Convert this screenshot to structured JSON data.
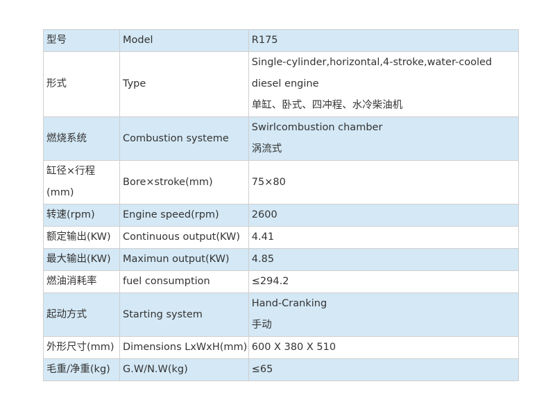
{
  "rows": [
    {
      "zh": "型号",
      "en": "Model",
      "value": [
        "R175"
      ]
    },
    {
      "zh": "形式",
      "en": "Type",
      "value": [
        "Single-cylinder,horizontal,4-stroke,water-cooled",
        "diesel engine",
        "单缸、卧式、四冲程、水冷柴油机"
      ]
    },
    {
      "zh": "燃烧系统",
      "en": "Combustion systeme",
      "value": [
        "Swirlcombustion chamber",
        "涡流式"
      ]
    },
    {
      "zh": [
        "缸径×行程",
        "(mm)"
      ],
      "en": "Bore×stroke(mm)",
      "value": [
        "75×80"
      ]
    },
    {
      "zh": "转速(rpm)",
      "en": "Engine speed(rpm)",
      "value": [
        "2600"
      ]
    },
    {
      "zh": "额定输出(KW)",
      "en": "Continuous output(KW)",
      "value": [
        "4.41"
      ]
    },
    {
      "zh": "最大输出(KW)",
      "en": "Maximun output(KW)",
      "value": [
        "4.85"
      ]
    },
    {
      "zh": "燃油消耗率",
      "en": "fuel consumption",
      "value": [
        "≤294.2"
      ]
    },
    {
      "zh": "起动方式",
      "en": "Starting system",
      "value": [
        "Hand-Cranking",
        "手动"
      ]
    },
    {
      "zh": "外形尺寸(mm)",
      "en": "Dimensions LxWxH(mm)",
      "value": [
        "600 X 380 X 510"
      ]
    },
    {
      "zh": "毛重/净重(kg)",
      "en": "G.W/N.W(kg)",
      "value": [
        "≤65"
      ]
    }
  ],
  "colors": {
    "row_shaded": "#d4e8f5",
    "row_plain": "#ffffff",
    "border": "#cfcfcf",
    "text": "#333333"
  }
}
